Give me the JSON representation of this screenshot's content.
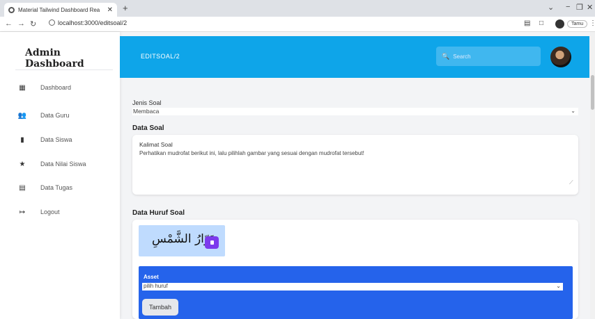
{
  "browser": {
    "tab_title": "Material Tailwind Dashboard Rea",
    "tab_close": "✕",
    "new_tab": "+",
    "url": "localhost:3000/editsoal/2",
    "profile_label": "Tamu",
    "icons": [
      "back-icon",
      "forward-icon",
      "reload-icon",
      "info-icon",
      "extension-icon",
      "sidebar-icon",
      "profile-icon",
      "menu-icon"
    ]
  },
  "sidebar": {
    "brand": "Admin Dashboard",
    "items": [
      {
        "label": "Dashboard",
        "icon": "dashboard-icon"
      },
      {
        "label": "Data Guru",
        "icon": "people-icon"
      },
      {
        "label": "Data Siswa",
        "icon": "book-icon"
      },
      {
        "label": "Data Nilai Siswa",
        "icon": "star-icon"
      },
      {
        "label": "Data Tugas",
        "icon": "assignment-icon"
      },
      {
        "label": "Logout",
        "icon": "logout-icon"
      }
    ]
  },
  "header": {
    "title": "EDITSOAL/2",
    "search_placeholder": "Search",
    "color": "#0ea5e9"
  },
  "form": {
    "jenis_label": "Jenis Soal",
    "jenis_value": "Membaca",
    "data_soal_heading": "Data Soal",
    "kalimat_label": "Kalimat Soal",
    "kalimat_value": "Perhatikan mudrofat berikut ini, lalu pilihlah gambar yang sesuai dengan mudrofat tersebut!",
    "huruf_heading": "Data Huruf Soal",
    "huruf_text": "دَوّارُ الشَّمْسِ",
    "asset_label": "Asset",
    "asset_value": "pilih huruf",
    "add_button": "Tambah"
  }
}
